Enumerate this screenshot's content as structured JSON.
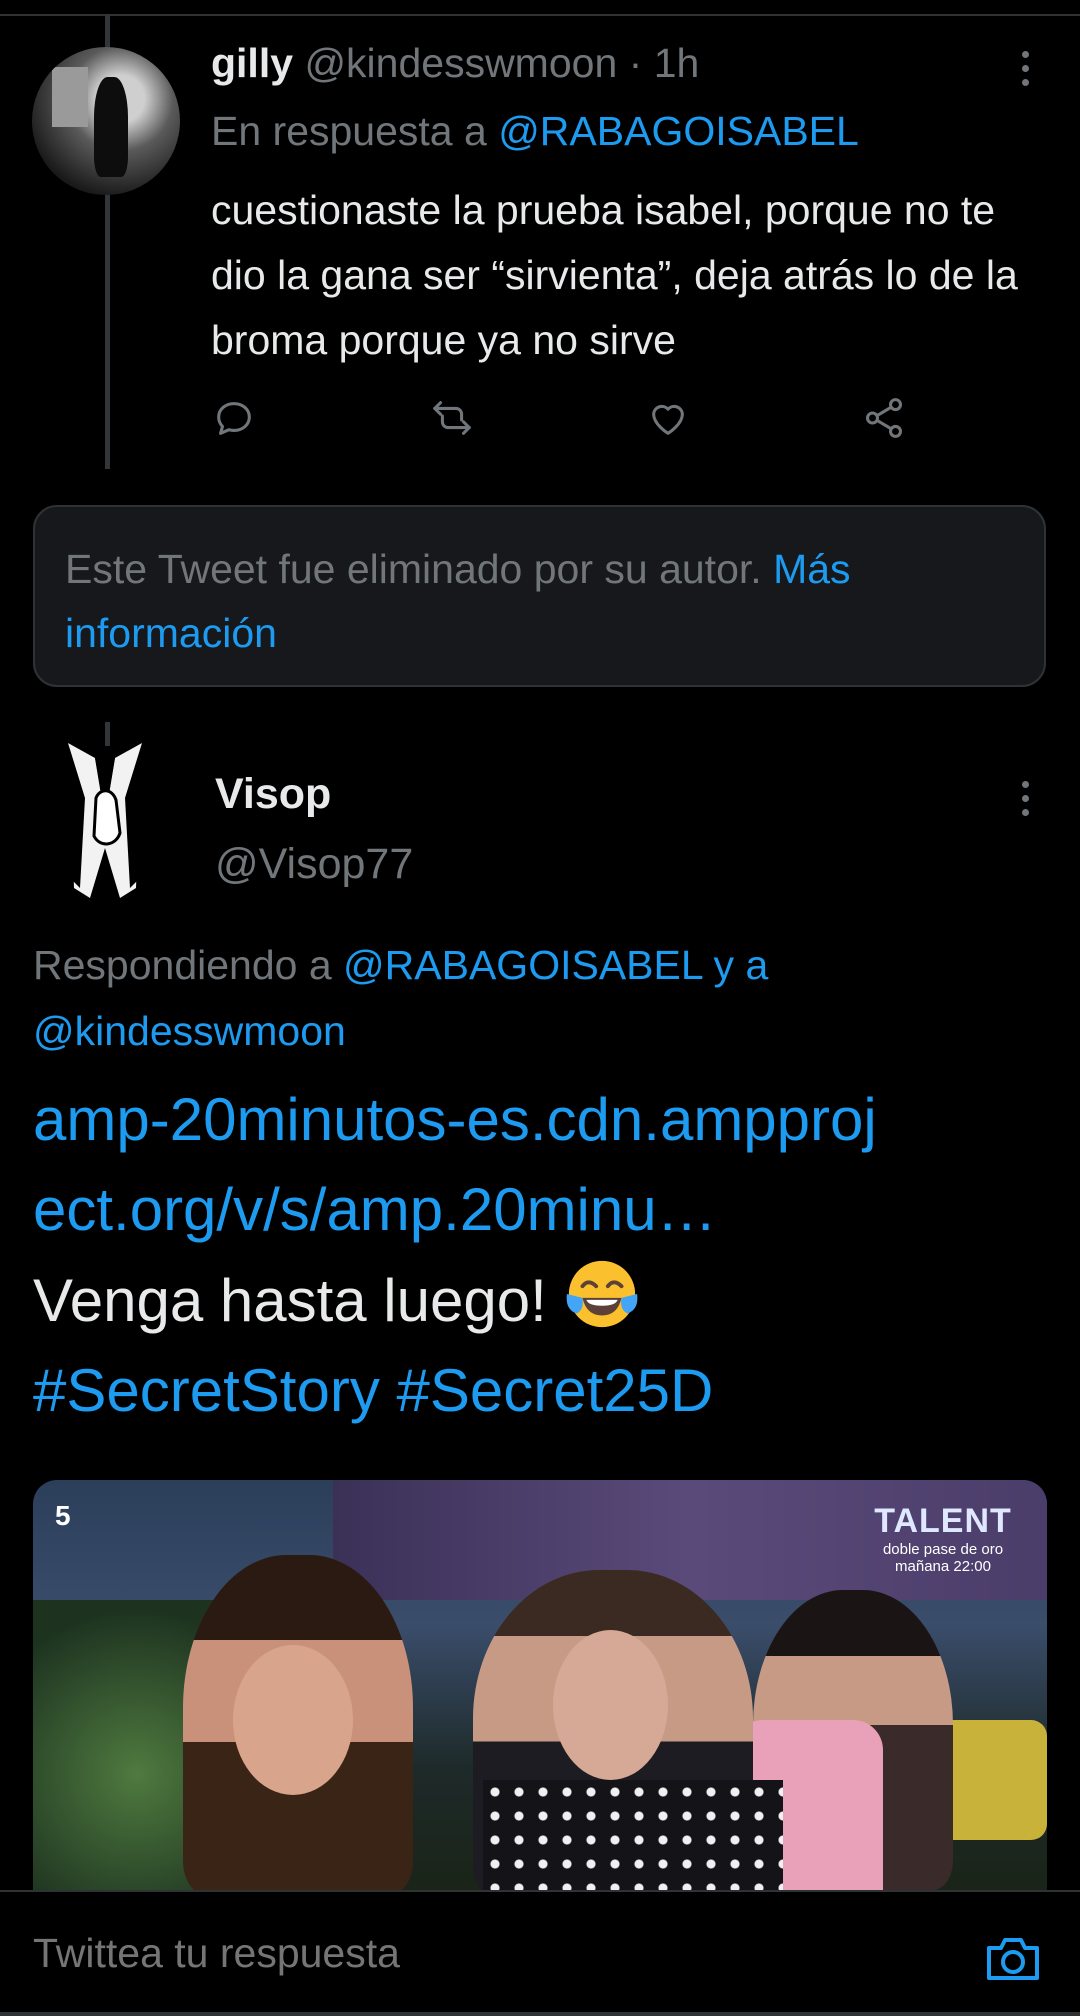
{
  "tweet1": {
    "name": "gilly",
    "handle": "@kindesswmoon",
    "time": "· 1h",
    "reply_prefix": "En respuesta a ",
    "reply_handle": "@RABAGOISABEL",
    "text": "cuestionaste la prueba isabel, porque no te dio la gana ser “sirvienta”, deja atrás lo de la broma porque ya no sirve"
  },
  "deleted": {
    "text": "Este Tweet fue eliminado por su autor. ",
    "link": "Más información"
  },
  "tweet2": {
    "name": "Visop",
    "handle": "@Visop77",
    "reply_prefix": "Respondiendo a ",
    "reply_handle1": "@RABAGOISABEL",
    "reply_join": " y a",
    "reply_handle2": "@kindesswmoon",
    "url_line1": "amp-20minutos-es.cdn.ampproj",
    "url_line2": "ect.org/v/s/amp.20minu…",
    "text": "Venga hasta luego! ",
    "hashtag1": "#SecretStory",
    "hashtag2": "#Secret25D",
    "emoji": "face-with-tears-of-joy"
  },
  "media": {
    "channel": "5",
    "ad_title": "TALENT",
    "ad_line1": "doble pase de oro",
    "ad_line2": "mañana 22:00"
  },
  "composer": {
    "placeholder": "Twittea tu respuesta"
  },
  "colors": {
    "accent": "#1d9bf0",
    "muted": "#71767b",
    "background": "#000000"
  }
}
